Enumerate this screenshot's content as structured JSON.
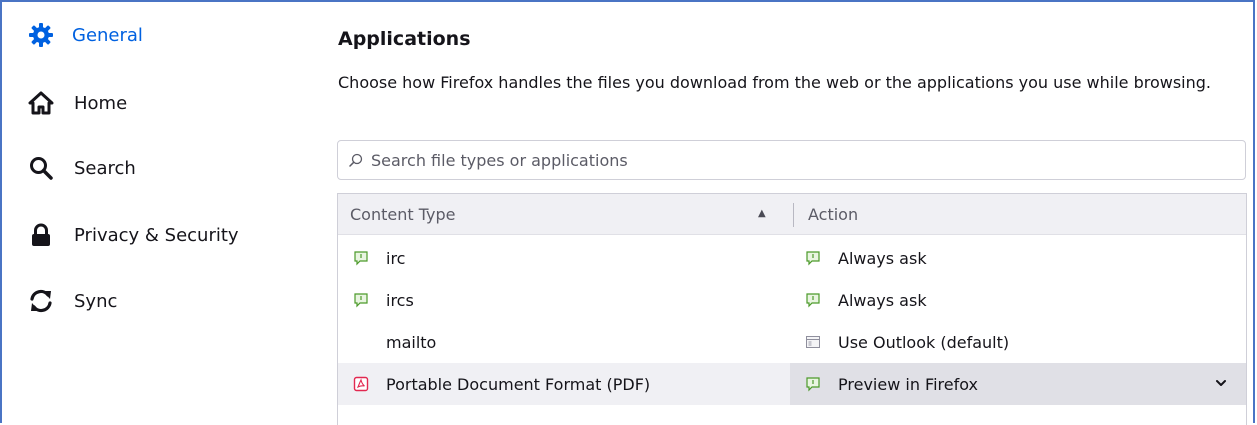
{
  "sidebar": {
    "items": [
      {
        "label": "General",
        "icon": "gear-icon",
        "selected": true
      },
      {
        "label": "Home",
        "icon": "home-icon",
        "selected": false
      },
      {
        "label": "Search",
        "icon": "search-icon",
        "selected": false
      },
      {
        "label": "Privacy & Security",
        "icon": "lock-icon",
        "selected": false
      },
      {
        "label": "Sync",
        "icon": "sync-icon",
        "selected": false
      }
    ]
  },
  "applications": {
    "title": "Applications",
    "description": "Choose how Firefox handles the files you download from the web or the applications you use while browsing.",
    "search_placeholder": "Search file types or applications",
    "columns": {
      "content_type": "Content Type",
      "action": "Action"
    },
    "rows": [
      {
        "content_type": "irc",
        "type_icon": "chat-icon",
        "action": "Always ask",
        "action_icon": "chat-icon"
      },
      {
        "content_type": "ircs",
        "type_icon": "chat-icon",
        "action": "Always ask",
        "action_icon": "chat-icon"
      },
      {
        "content_type": "mailto",
        "type_icon": "",
        "action": "Use Outlook (default)",
        "action_icon": "app-window-icon"
      },
      {
        "content_type": "Portable Document Format (PDF)",
        "type_icon": "pdf-icon",
        "action": "Preview in Firefox",
        "action_icon": "chat-icon",
        "selected": true
      }
    ]
  },
  "colors": {
    "accent": "#0061e0",
    "frame": "#4a74c4",
    "pdf": "#e22850",
    "chat": "#4c9a2a"
  }
}
